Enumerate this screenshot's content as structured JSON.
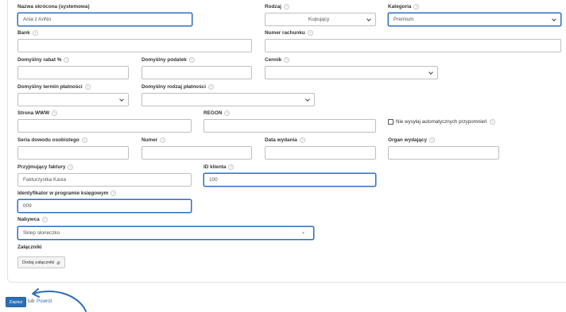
{
  "form": {
    "short_name": {
      "label": "Nazwa skrócona (systemowa)",
      "value": "Ania z AnNo"
    },
    "type": {
      "label": "Rodzaj",
      "value": "Kupujący"
    },
    "category": {
      "label": "Kategoria",
      "value": "Premium"
    },
    "bank": {
      "label": "Bank",
      "value": ""
    },
    "account_number": {
      "label": "Numer rachunku",
      "value": ""
    },
    "default_discount": {
      "label": "Domyślny rabat %",
      "value": ""
    },
    "default_tax": {
      "label": "Domyślny podatek",
      "value": ""
    },
    "price_list": {
      "label": "Cennik",
      "value": ""
    },
    "default_payment_term": {
      "label": "Domyślny termin płatności",
      "value": ""
    },
    "default_payment_method": {
      "label": "Domyślny rodzaj płatności",
      "value": ""
    },
    "website": {
      "label": "Strona WWW",
      "value": ""
    },
    "regon": {
      "label": "REGON",
      "value": ""
    },
    "no_reminders": {
      "label": "Nie wysyłaj automatycznych przypomnień",
      "checked": false
    },
    "id_series": {
      "label": "Seria dowodu osobistego",
      "value": ""
    },
    "id_number": {
      "label": "Numer",
      "value": ""
    },
    "issue_date": {
      "label": "Data wydania",
      "value": ""
    },
    "issuing_authority": {
      "label": "Organ wydający",
      "value": ""
    },
    "invoice_receiver": {
      "label": "Przyjmujący faktury",
      "value": "Fakturzystka Kasia"
    },
    "client_id": {
      "label": "ID klienta",
      "value": "100"
    },
    "accounting_id": {
      "label": "Identyfikator w programie księgowym",
      "value": "009"
    },
    "buyer": {
      "label": "Nabywca",
      "value": "Sklep słoneczko"
    },
    "attachments": {
      "label": "Załączniki",
      "button": "Dodaj załączniki"
    }
  },
  "help_mark": "?",
  "footer": {
    "save": "Zapisz",
    "or": "lub",
    "back": "Powrót"
  },
  "icons": {
    "help": "question-circle-icon",
    "attach": "paperclip-icon",
    "dropdown": "chevron-down-icon"
  },
  "colors": {
    "accent": "#2c6fb7",
    "focus_border": "#2f6fbf"
  }
}
